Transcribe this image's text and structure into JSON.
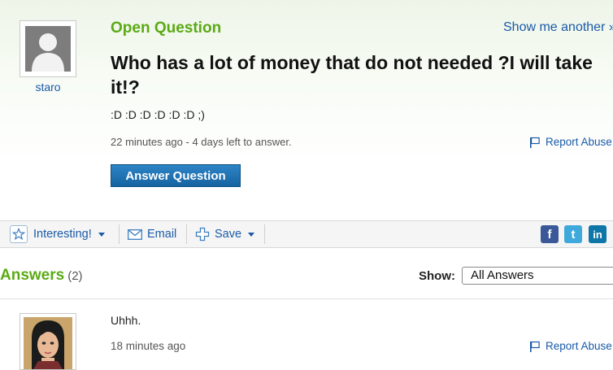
{
  "question": {
    "status_label": "Open Question",
    "show_another": "Show me another »",
    "title": "Who has a lot of money that do not needed ?I will take it!?",
    "detail": ":D :D :D :D :D :D ;)",
    "meta": "22 minutes ago - 4 days left to answer.",
    "report_abuse": "Report Abuse",
    "answer_button": "Answer Question"
  },
  "asker": {
    "name": "staro"
  },
  "toolbar": {
    "interesting": "Interesting!",
    "email": "Email",
    "save": "Save"
  },
  "social": {
    "facebook": "f",
    "twitter": "t",
    "linkedin": "in"
  },
  "answers": {
    "heading": "Answers",
    "count": "(2)",
    "show_label": "Show:",
    "filter_value": "All Answers",
    "items": [
      {
        "text": "Uhhh.",
        "time": "18 minutes ago",
        "report_abuse": "Report Abuse"
      }
    ]
  },
  "colors": {
    "brand_green": "#5aaa15",
    "link_blue": "#1a5aa8",
    "button_blue": "#1663a1",
    "facebook": "#3b5998",
    "twitter": "#3fa9dc",
    "linkedin": "#0e76a8"
  }
}
